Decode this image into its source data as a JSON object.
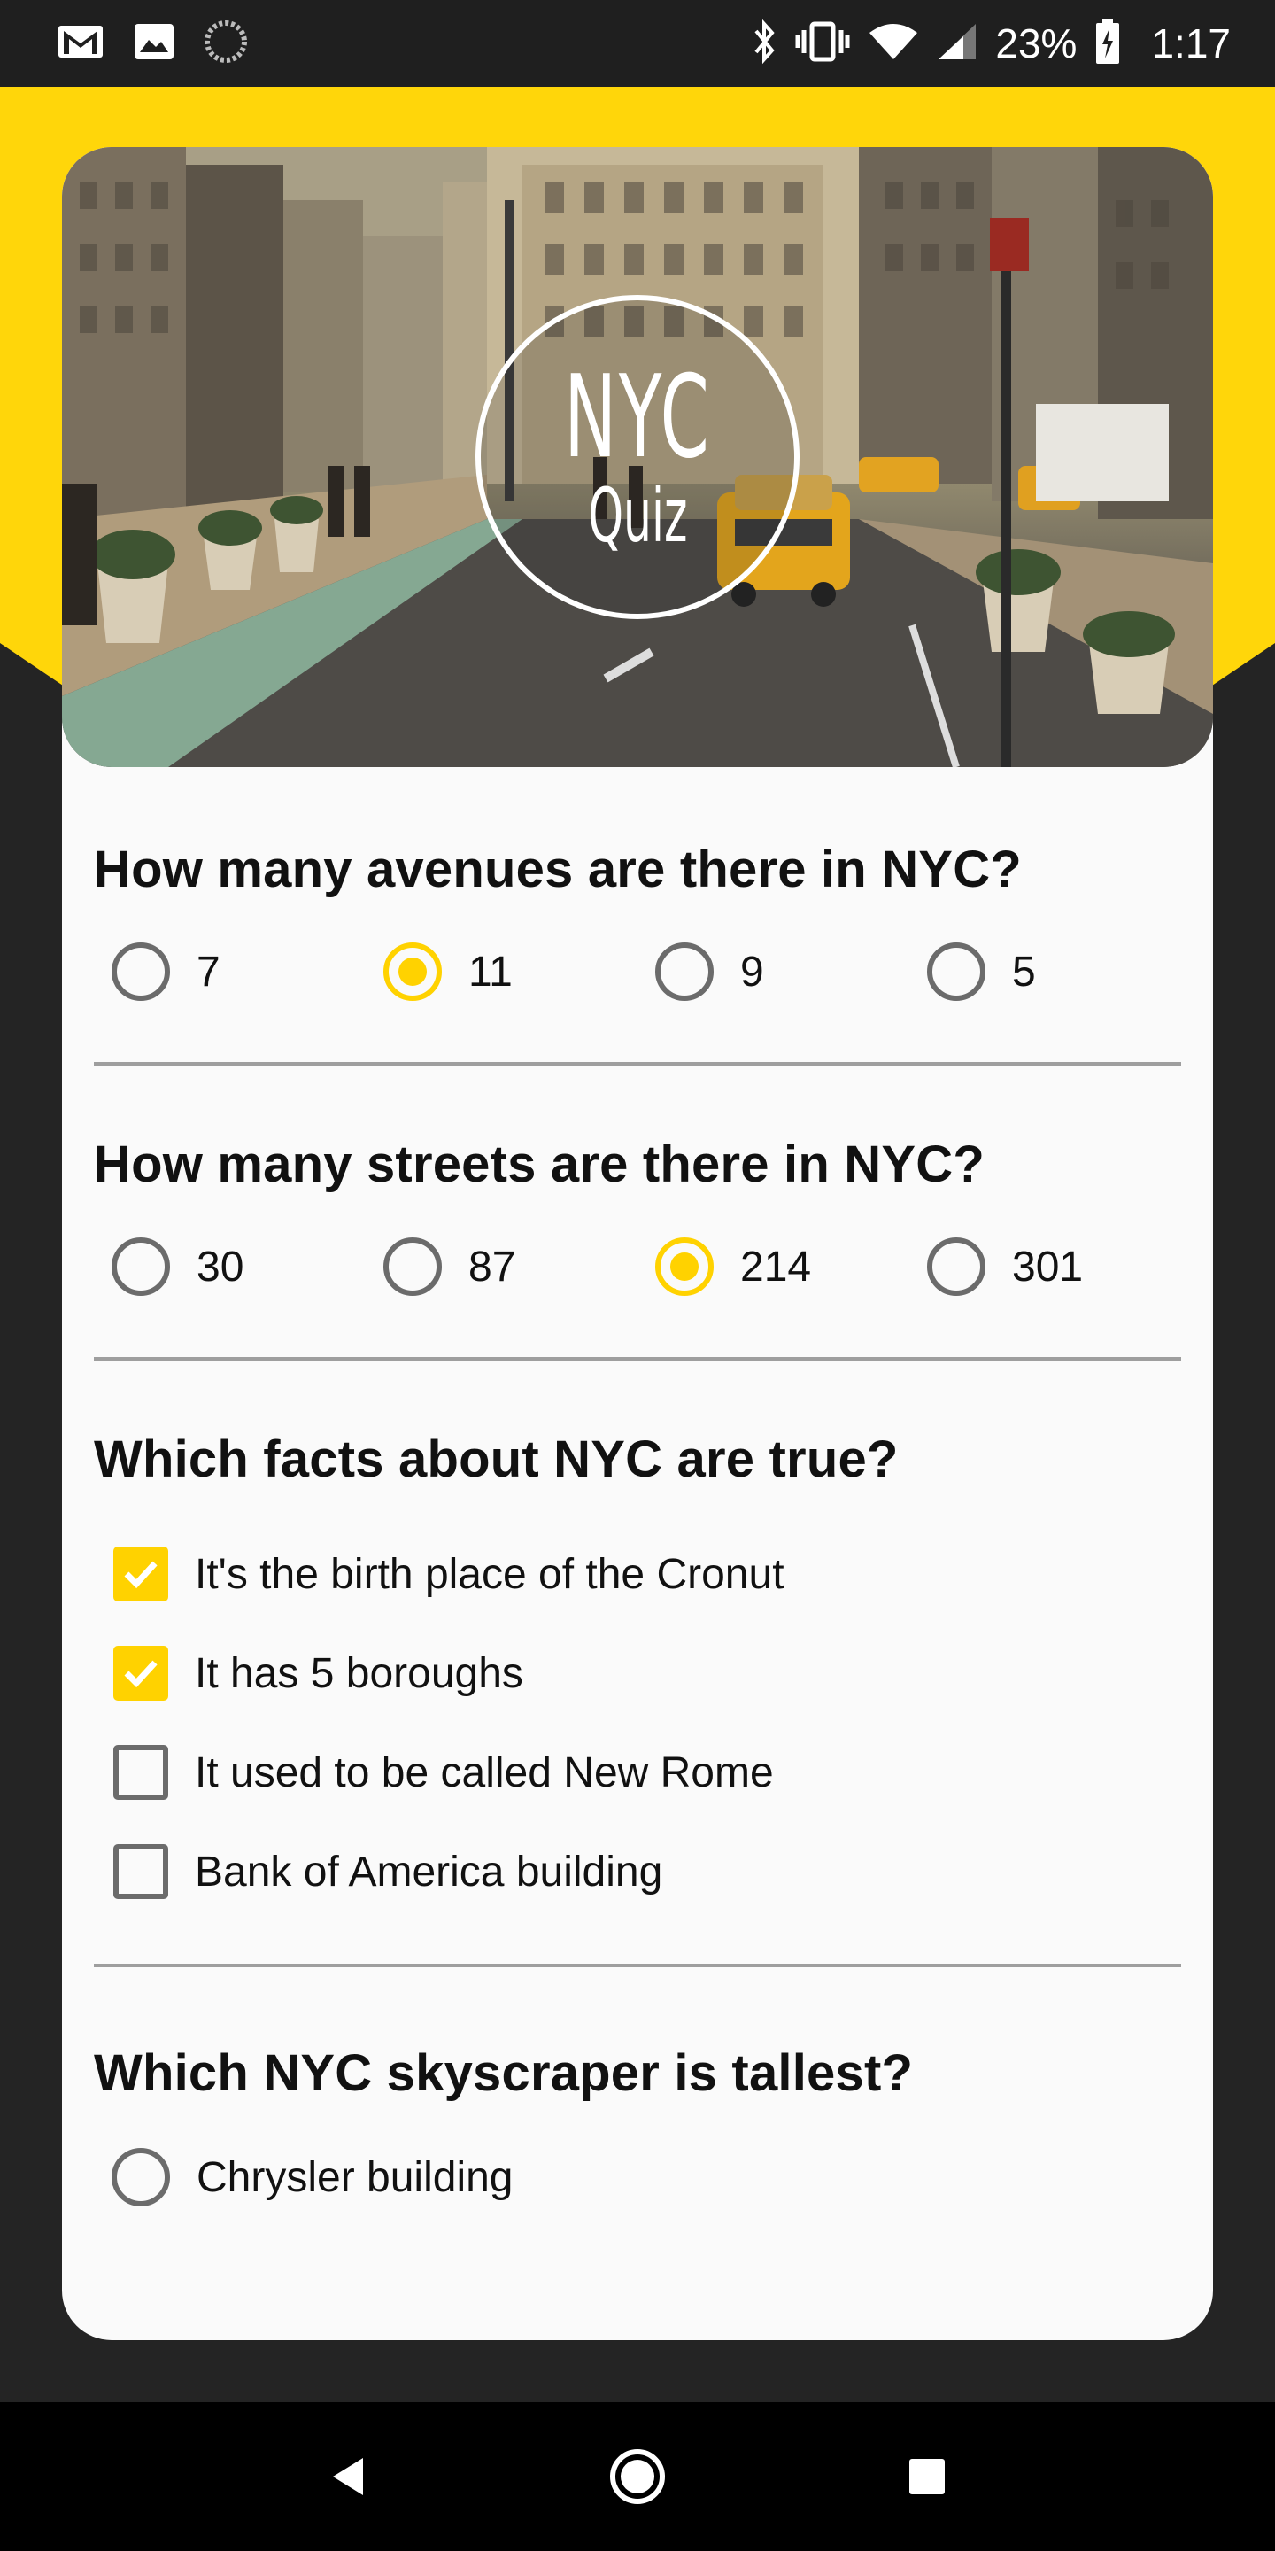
{
  "status_bar": {
    "icons": [
      "gmail-icon",
      "image-icon",
      "sync-icon",
      "bluetooth-icon",
      "vibrate-icon",
      "wifi-icon",
      "signal-icon",
      "battery-charging-icon"
    ],
    "battery": "23%",
    "time": "1:17"
  },
  "hero": {
    "logo_line1": "NYC",
    "logo_line2": "Quiz"
  },
  "questions": [
    {
      "title": "How many avenues are there in NYC?",
      "type": "radio",
      "options": [
        "7",
        "11",
        "9",
        "5"
      ],
      "selected": "11"
    },
    {
      "title": "How many streets are there in NYC?",
      "type": "radio",
      "options": [
        "30",
        "87",
        "214",
        "301"
      ],
      "selected": "214"
    },
    {
      "title": "Which facts about NYC are true?",
      "type": "checkbox",
      "options": [
        "It's the birth place of the Cronut",
        "It has 5 boroughs",
        "It used to be called New Rome",
        "Bank of America building"
      ],
      "checked": [
        "It's the birth place of the Cronut",
        "It has 5 boroughs"
      ]
    },
    {
      "title": "Which NYC skyscraper is tallest?",
      "type": "radio",
      "options": [
        "Chrysler building"
      ],
      "selected": null
    }
  ],
  "colors": {
    "accent": "#ffd200",
    "header_band": "#ffd60a",
    "background": "#242424",
    "card": "#fafafa"
  },
  "nav_bar": {
    "icons": [
      "back-icon",
      "home-icon",
      "recents-icon"
    ]
  }
}
